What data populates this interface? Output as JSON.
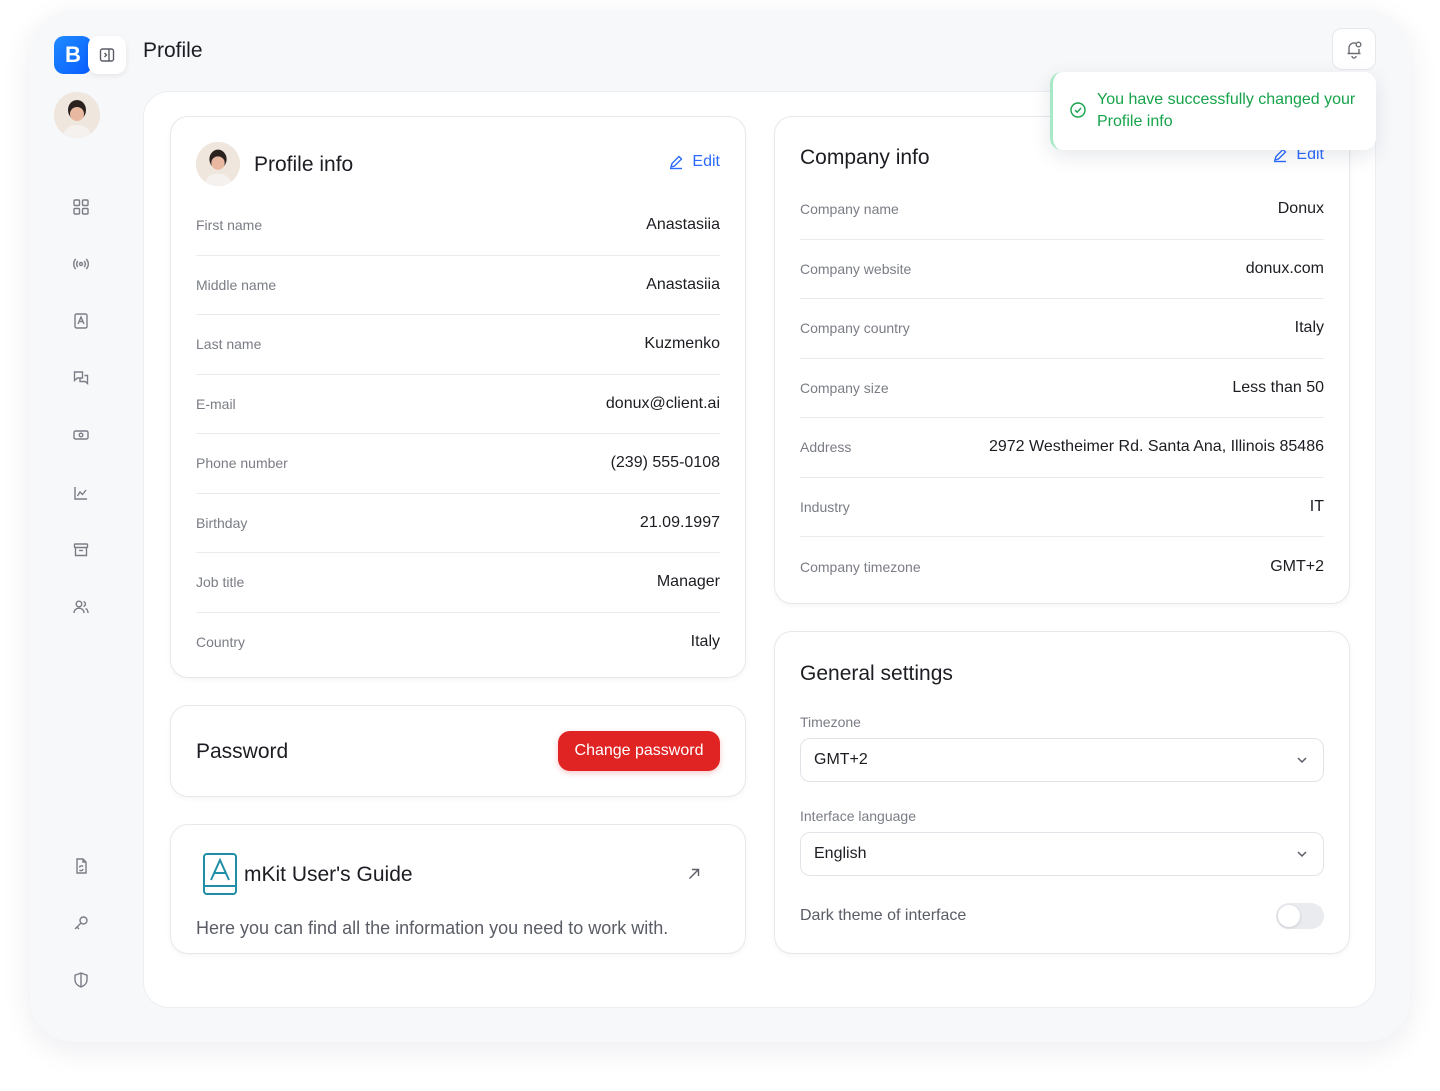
{
  "header": {
    "title": "Profile"
  },
  "brand": {
    "logo_letter": "B",
    "accent": "#0a5cff"
  },
  "toast": {
    "message": "You have successfully changed your Profile info",
    "color": "#16a34a"
  },
  "sidebar": {
    "items": [
      {
        "name": "dashboard-icon"
      },
      {
        "name": "broadcast-icon"
      },
      {
        "name": "contact-book-icon"
      },
      {
        "name": "chat-icon"
      },
      {
        "name": "money-icon"
      },
      {
        "name": "chart-icon"
      },
      {
        "name": "archive-icon"
      },
      {
        "name": "users-icon"
      }
    ],
    "bottom_items": [
      {
        "name": "document-sync-icon"
      },
      {
        "name": "key-icon"
      },
      {
        "name": "shield-icon"
      }
    ]
  },
  "profile": {
    "title": "Profile info",
    "edit_label": "Edit",
    "rows": [
      {
        "label": "First name",
        "value": "Anastasiia"
      },
      {
        "label": "Middle name",
        "value": "Anastasiia"
      },
      {
        "label": "Last name",
        "value": "Kuzmenko"
      },
      {
        "label": "E-mail",
        "value": "donux@client.ai"
      },
      {
        "label": "Phone number",
        "value": "(239) 555-0108"
      },
      {
        "label": "Birthday",
        "value": "21.09.1997"
      },
      {
        "label": "Job title",
        "value": "Manager"
      },
      {
        "label": "Country",
        "value": "Italy"
      }
    ]
  },
  "password": {
    "title": "Password",
    "button_label": "Change password",
    "button_color": "#e02424"
  },
  "guide": {
    "title": "mKit User's Guide",
    "description": "Here you can find all the information you need to work with."
  },
  "company": {
    "title": "Company info",
    "edit_label": "Edit",
    "rows": [
      {
        "label": "Company name",
        "value": "Donux"
      },
      {
        "label": "Company website",
        "value": "donux.com"
      },
      {
        "label": "Company country",
        "value": "Italy"
      },
      {
        "label": "Company size",
        "value": "Less than 50"
      },
      {
        "label": "Address",
        "value": "2972 Westheimer Rd. Santa Ana, Illinois 85486"
      },
      {
        "label": "Industry",
        "value": "IT"
      },
      {
        "label": "Company timezone",
        "value": "GMT+2"
      }
    ]
  },
  "settings": {
    "title": "General settings",
    "timezone_label": "Timezone",
    "timezone_value": "GMT+2",
    "language_label": "Interface language",
    "language_value": "English",
    "dark_theme_label": "Dark theme of interface",
    "dark_theme_on": false
  }
}
